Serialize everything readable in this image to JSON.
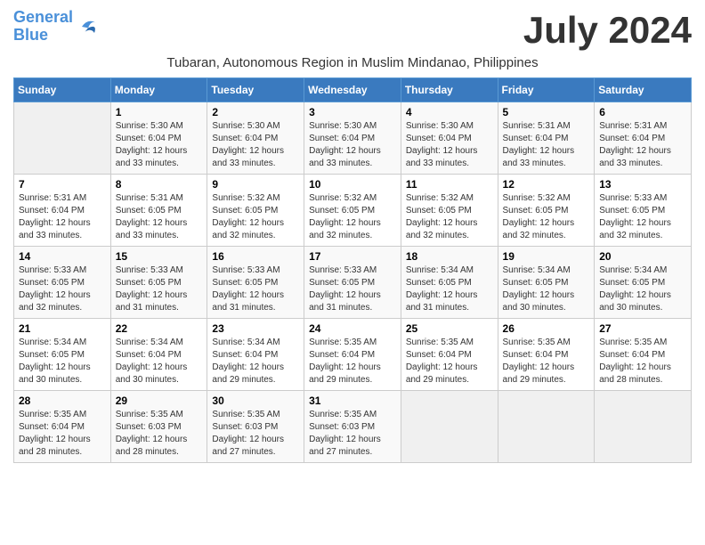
{
  "logo": {
    "line1": "General",
    "line2": "Blue"
  },
  "month": "July 2024",
  "location": "Tubaran, Autonomous Region in Muslim Mindanao, Philippines",
  "days_of_week": [
    "Sunday",
    "Monday",
    "Tuesday",
    "Wednesday",
    "Thursday",
    "Friday",
    "Saturday"
  ],
  "weeks": [
    [
      {
        "day": "",
        "info": ""
      },
      {
        "day": "1",
        "info": "Sunrise: 5:30 AM\nSunset: 6:04 PM\nDaylight: 12 hours\nand 33 minutes."
      },
      {
        "day": "2",
        "info": "Sunrise: 5:30 AM\nSunset: 6:04 PM\nDaylight: 12 hours\nand 33 minutes."
      },
      {
        "day": "3",
        "info": "Sunrise: 5:30 AM\nSunset: 6:04 PM\nDaylight: 12 hours\nand 33 minutes."
      },
      {
        "day": "4",
        "info": "Sunrise: 5:30 AM\nSunset: 6:04 PM\nDaylight: 12 hours\nand 33 minutes."
      },
      {
        "day": "5",
        "info": "Sunrise: 5:31 AM\nSunset: 6:04 PM\nDaylight: 12 hours\nand 33 minutes."
      },
      {
        "day": "6",
        "info": "Sunrise: 5:31 AM\nSunset: 6:04 PM\nDaylight: 12 hours\nand 33 minutes."
      }
    ],
    [
      {
        "day": "7",
        "info": "Sunrise: 5:31 AM\nSunset: 6:04 PM\nDaylight: 12 hours\nand 33 minutes."
      },
      {
        "day": "8",
        "info": "Sunrise: 5:31 AM\nSunset: 6:05 PM\nDaylight: 12 hours\nand 33 minutes."
      },
      {
        "day": "9",
        "info": "Sunrise: 5:32 AM\nSunset: 6:05 PM\nDaylight: 12 hours\nand 32 minutes."
      },
      {
        "day": "10",
        "info": "Sunrise: 5:32 AM\nSunset: 6:05 PM\nDaylight: 12 hours\nand 32 minutes."
      },
      {
        "day": "11",
        "info": "Sunrise: 5:32 AM\nSunset: 6:05 PM\nDaylight: 12 hours\nand 32 minutes."
      },
      {
        "day": "12",
        "info": "Sunrise: 5:32 AM\nSunset: 6:05 PM\nDaylight: 12 hours\nand 32 minutes."
      },
      {
        "day": "13",
        "info": "Sunrise: 5:33 AM\nSunset: 6:05 PM\nDaylight: 12 hours\nand 32 minutes."
      }
    ],
    [
      {
        "day": "14",
        "info": "Sunrise: 5:33 AM\nSunset: 6:05 PM\nDaylight: 12 hours\nand 32 minutes."
      },
      {
        "day": "15",
        "info": "Sunrise: 5:33 AM\nSunset: 6:05 PM\nDaylight: 12 hours\nand 31 minutes."
      },
      {
        "day": "16",
        "info": "Sunrise: 5:33 AM\nSunset: 6:05 PM\nDaylight: 12 hours\nand 31 minutes."
      },
      {
        "day": "17",
        "info": "Sunrise: 5:33 AM\nSunset: 6:05 PM\nDaylight: 12 hours\nand 31 minutes."
      },
      {
        "day": "18",
        "info": "Sunrise: 5:34 AM\nSunset: 6:05 PM\nDaylight: 12 hours\nand 31 minutes."
      },
      {
        "day": "19",
        "info": "Sunrise: 5:34 AM\nSunset: 6:05 PM\nDaylight: 12 hours\nand 30 minutes."
      },
      {
        "day": "20",
        "info": "Sunrise: 5:34 AM\nSunset: 6:05 PM\nDaylight: 12 hours\nand 30 minutes."
      }
    ],
    [
      {
        "day": "21",
        "info": "Sunrise: 5:34 AM\nSunset: 6:05 PM\nDaylight: 12 hours\nand 30 minutes."
      },
      {
        "day": "22",
        "info": "Sunrise: 5:34 AM\nSunset: 6:04 PM\nDaylight: 12 hours\nand 30 minutes."
      },
      {
        "day": "23",
        "info": "Sunrise: 5:34 AM\nSunset: 6:04 PM\nDaylight: 12 hours\nand 29 minutes."
      },
      {
        "day": "24",
        "info": "Sunrise: 5:35 AM\nSunset: 6:04 PM\nDaylight: 12 hours\nand 29 minutes."
      },
      {
        "day": "25",
        "info": "Sunrise: 5:35 AM\nSunset: 6:04 PM\nDaylight: 12 hours\nand 29 minutes."
      },
      {
        "day": "26",
        "info": "Sunrise: 5:35 AM\nSunset: 6:04 PM\nDaylight: 12 hours\nand 29 minutes."
      },
      {
        "day": "27",
        "info": "Sunrise: 5:35 AM\nSunset: 6:04 PM\nDaylight: 12 hours\nand 28 minutes."
      }
    ],
    [
      {
        "day": "28",
        "info": "Sunrise: 5:35 AM\nSunset: 6:04 PM\nDaylight: 12 hours\nand 28 minutes."
      },
      {
        "day": "29",
        "info": "Sunrise: 5:35 AM\nSunset: 6:03 PM\nDaylight: 12 hours\nand 28 minutes."
      },
      {
        "day": "30",
        "info": "Sunrise: 5:35 AM\nSunset: 6:03 PM\nDaylight: 12 hours\nand 27 minutes."
      },
      {
        "day": "31",
        "info": "Sunrise: 5:35 AM\nSunset: 6:03 PM\nDaylight: 12 hours\nand 27 minutes."
      },
      {
        "day": "",
        "info": ""
      },
      {
        "day": "",
        "info": ""
      },
      {
        "day": "",
        "info": ""
      }
    ]
  ]
}
